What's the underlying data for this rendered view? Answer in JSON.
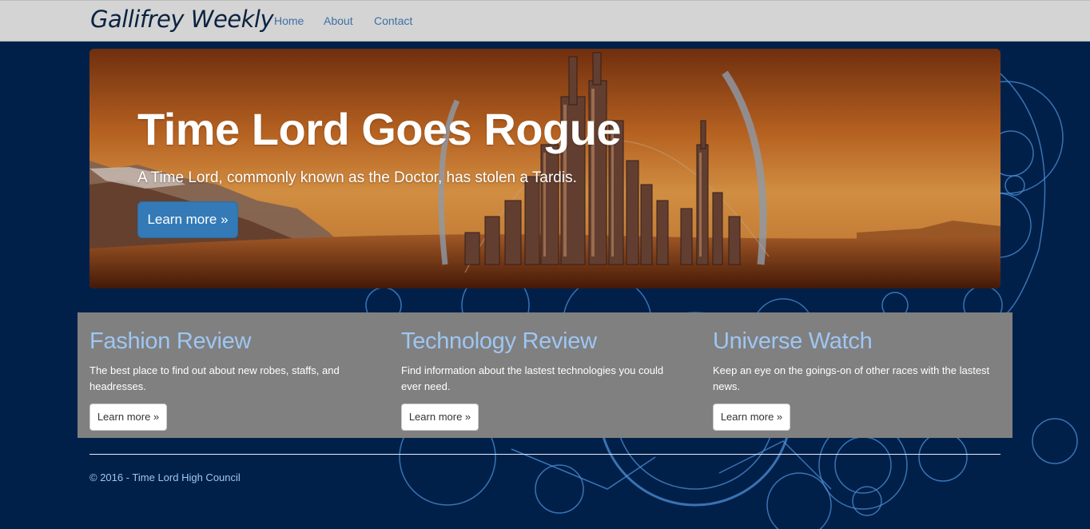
{
  "navbar": {
    "brand": "Gallifrey Weekly",
    "links": [
      {
        "label": "Home"
      },
      {
        "label": "About"
      },
      {
        "label": "Contact"
      }
    ]
  },
  "hero": {
    "title": "Time Lord Goes Rogue",
    "subtitle": "A Time Lord, commonly known as the Doctor, has stolen a Tardis.",
    "button_label": "Learn more »"
  },
  "features": [
    {
      "heading": "Fashion Review",
      "text": "The best place to find out about new robes, staffs, and headresses.",
      "button_label": "Learn more »"
    },
    {
      "heading": "Technology Review",
      "text": "Find information about the lastest technologies you could ever need.",
      "button_label": "Learn more »"
    },
    {
      "heading": "Universe Watch",
      "text": "Keep an eye on the goings-on of other races with the lastest news.",
      "button_label": "Learn more »"
    }
  ],
  "footer": {
    "text": "© 2016 - Time Lord High Council"
  },
  "colors": {
    "page_bg": "#00204a",
    "navbar_bg": "#d4d4d4",
    "brand": "#0b2340",
    "nav_link": "#3f6fa6",
    "primary_button": "#337ab7",
    "feature_bg": "#808080",
    "feature_heading": "#9ec6f2"
  }
}
